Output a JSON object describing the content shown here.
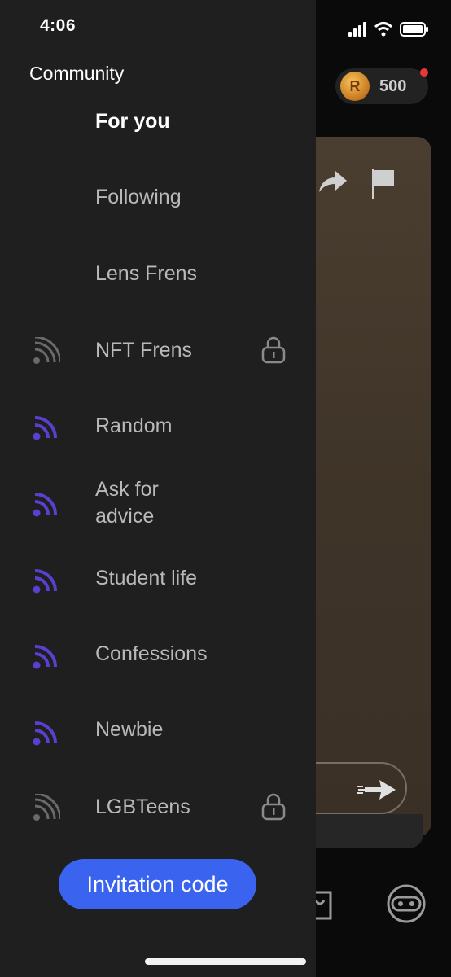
{
  "status_bar": {
    "time": "4:06"
  },
  "drawer": {
    "title": "Community",
    "items": [
      {
        "label": "For you",
        "active": true,
        "feed_icon": null,
        "locked": false
      },
      {
        "label": "Following",
        "active": false,
        "feed_icon": null,
        "locked": false
      },
      {
        "label": "Lens Frens",
        "active": false,
        "feed_icon": null,
        "locked": false
      },
      {
        "label": "NFT Frens",
        "active": false,
        "feed_icon": "rss-icon-gray",
        "locked": true
      },
      {
        "label": "Random",
        "active": false,
        "feed_icon": "rss-icon-purple",
        "locked": false
      },
      {
        "label": "Ask for advice",
        "active": false,
        "feed_icon": "rss-icon-purple",
        "locked": false
      },
      {
        "label": "Student life",
        "active": false,
        "feed_icon": "rss-icon-purple",
        "locked": false
      },
      {
        "label": "Confessions",
        "active": false,
        "feed_icon": "rss-icon-purple",
        "locked": false
      },
      {
        "label": "Newbie",
        "active": false,
        "feed_icon": "rss-icon-purple",
        "locked": false
      },
      {
        "label": "LGBTeens",
        "active": false,
        "feed_icon": "rss-icon-gray",
        "locked": true
      }
    ],
    "invite_button": "Invitation code"
  },
  "background": {
    "coin_symbol": "R",
    "coin_count": "500"
  },
  "colors": {
    "drawer_bg": "#1f1f1f",
    "accent_blue": "#3a64f0",
    "feed_purple": "#5b3fd0",
    "feed_gray": "#6a6a6a",
    "card_brown": "#3f3428"
  }
}
